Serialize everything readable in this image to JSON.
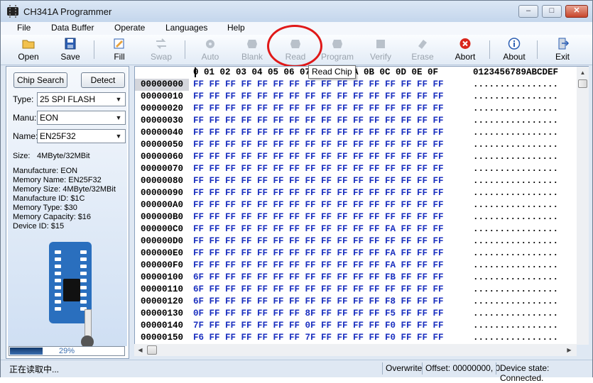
{
  "window": {
    "title": "CH341A Programmer"
  },
  "titlebar_buttons": {
    "minimize": "–",
    "maximize": "□",
    "close": "✕"
  },
  "menu": [
    "File",
    "Data Buffer",
    "Operate",
    "Languages",
    "Help"
  ],
  "toolbar": {
    "open": "Open",
    "save": "Save",
    "fill": "Fill",
    "swap": "Swap",
    "auto": "Auto",
    "blank": "Blank",
    "read": "Read",
    "program": "Program",
    "verify": "Verify",
    "erase": "Erase",
    "abort": "Abort",
    "about": "About",
    "exit": "Exit",
    "tooltip": "Read Chip"
  },
  "left": {
    "chip_search": "Chip Search",
    "detect": "Detect",
    "type_label": "Type:",
    "type_value": "25 SPI FLASH",
    "manu_label": "Manu:",
    "manu_value": "EON",
    "name_label": "Name:",
    "name_value": "EN25F32",
    "size_label": "Size:",
    "size_value": "4MByte/32MBit",
    "info": [
      "Manufacture: EON",
      "Memory Name: EN25F32",
      "Memory Size: 4MByte/32MBit",
      "Manufacture ID: $1C",
      "Memory Type: $30",
      "Memory Capacity: $16",
      "Device ID: $15"
    ],
    "progress_value": 0.29,
    "progress_text": "29%"
  },
  "hex": {
    "header_cols": "0 01 02 03 04 05 06 07 08 09 0A 0B 0C 0D 0E 0F",
    "header_ascii": "0123456789ABCDEF",
    "rows": [
      {
        "addr": "00000000",
        "bytes": "FF FF FF FF FF FF FF FF FF FF FF FF FF FF FF FF",
        "ascii": "................"
      },
      {
        "addr": "00000010",
        "bytes": "FF FF FF FF FF FF FF FF FF FF FF FF FF FF FF FF",
        "ascii": "................"
      },
      {
        "addr": "00000020",
        "bytes": "FF FF FF FF FF FF FF FF FF FF FF FF FF FF FF FF",
        "ascii": "................"
      },
      {
        "addr": "00000030",
        "bytes": "FF FF FF FF FF FF FF FF FF FF FF FF FF FF FF FF",
        "ascii": "................"
      },
      {
        "addr": "00000040",
        "bytes": "FF FF FF FF FF FF FF FF FF FF FF FF FF FF FF FF",
        "ascii": "................"
      },
      {
        "addr": "00000050",
        "bytes": "FF FF FF FF FF FF FF FF FF FF FF FF FF FF FF FF",
        "ascii": "................"
      },
      {
        "addr": "00000060",
        "bytes": "FF FF FF FF FF FF FF FF FF FF FF FF FF FF FF FF",
        "ascii": "................"
      },
      {
        "addr": "00000070",
        "bytes": "FF FF FF FF FF FF FF FF FF FF FF FF FF FF FF FF",
        "ascii": "................"
      },
      {
        "addr": "00000080",
        "bytes": "FF FF FF FF FF FF FF FF FF FF FF FF FF FF FF FF",
        "ascii": "................"
      },
      {
        "addr": "00000090",
        "bytes": "FF FF FF FF FF FF FF FF FF FF FF FF FF FF FF FF",
        "ascii": "................"
      },
      {
        "addr": "000000A0",
        "bytes": "FF FF FF FF FF FF FF FF FF FF FF FF FF FF FF FF",
        "ascii": "................"
      },
      {
        "addr": "000000B0",
        "bytes": "FF FF FF FF FF FF FF FF FF FF FF FF FF FF FF FF",
        "ascii": "................"
      },
      {
        "addr": "000000C0",
        "bytes": "FF FF FF FF FF FF FF FF FF FF FF FF FA FF FF FF",
        "ascii": "................"
      },
      {
        "addr": "000000D0",
        "bytes": "FF FF FF FF FF FF FF FF FF FF FF FF FF FF FF FF",
        "ascii": "................"
      },
      {
        "addr": "000000E0",
        "bytes": "FF FF FF FF FF FF FF FF FF FF FF FF FA FF FF FF",
        "ascii": "................"
      },
      {
        "addr": "000000F0",
        "bytes": "FF FF FF FF FF FF FF FF FF FF FF FF FA FF FF FF",
        "ascii": "................"
      },
      {
        "addr": "00000100",
        "bytes": "6F FF FF FF FF FF FF FF FF FF FF FF FB FF FF FF",
        "ascii": "................"
      },
      {
        "addr": "00000110",
        "bytes": "6F FF FF FF FF FF FF FF FF FF FF FF FF FF FF FF",
        "ascii": "................"
      },
      {
        "addr": "00000120",
        "bytes": "6F FF FF FF FF FF FF FF FF FF FF FF F8 FF FF FF",
        "ascii": "................"
      },
      {
        "addr": "00000130",
        "bytes": "0F FF FF FF FF FF FF 8F FF FF FF FF F5 FF FF FF",
        "ascii": "................"
      },
      {
        "addr": "00000140",
        "bytes": "7F FF FF FF FF FF FF 0F FF FF FF FF F0 FF FF FF",
        "ascii": "................"
      },
      {
        "addr": "00000150",
        "bytes": "F6 FF FF FF FF FF FF 7F FF FF FF FF F0 FF FF FF",
        "ascii": "................"
      }
    ]
  },
  "status": {
    "message": "正在读取中...",
    "mode": "Overwrite",
    "offset": "Offset: 00000000, 0",
    "device": "Device state: Connected."
  },
  "colors": {
    "hex_text": "#1a2fbf",
    "highlight_circle": "#e01818"
  }
}
